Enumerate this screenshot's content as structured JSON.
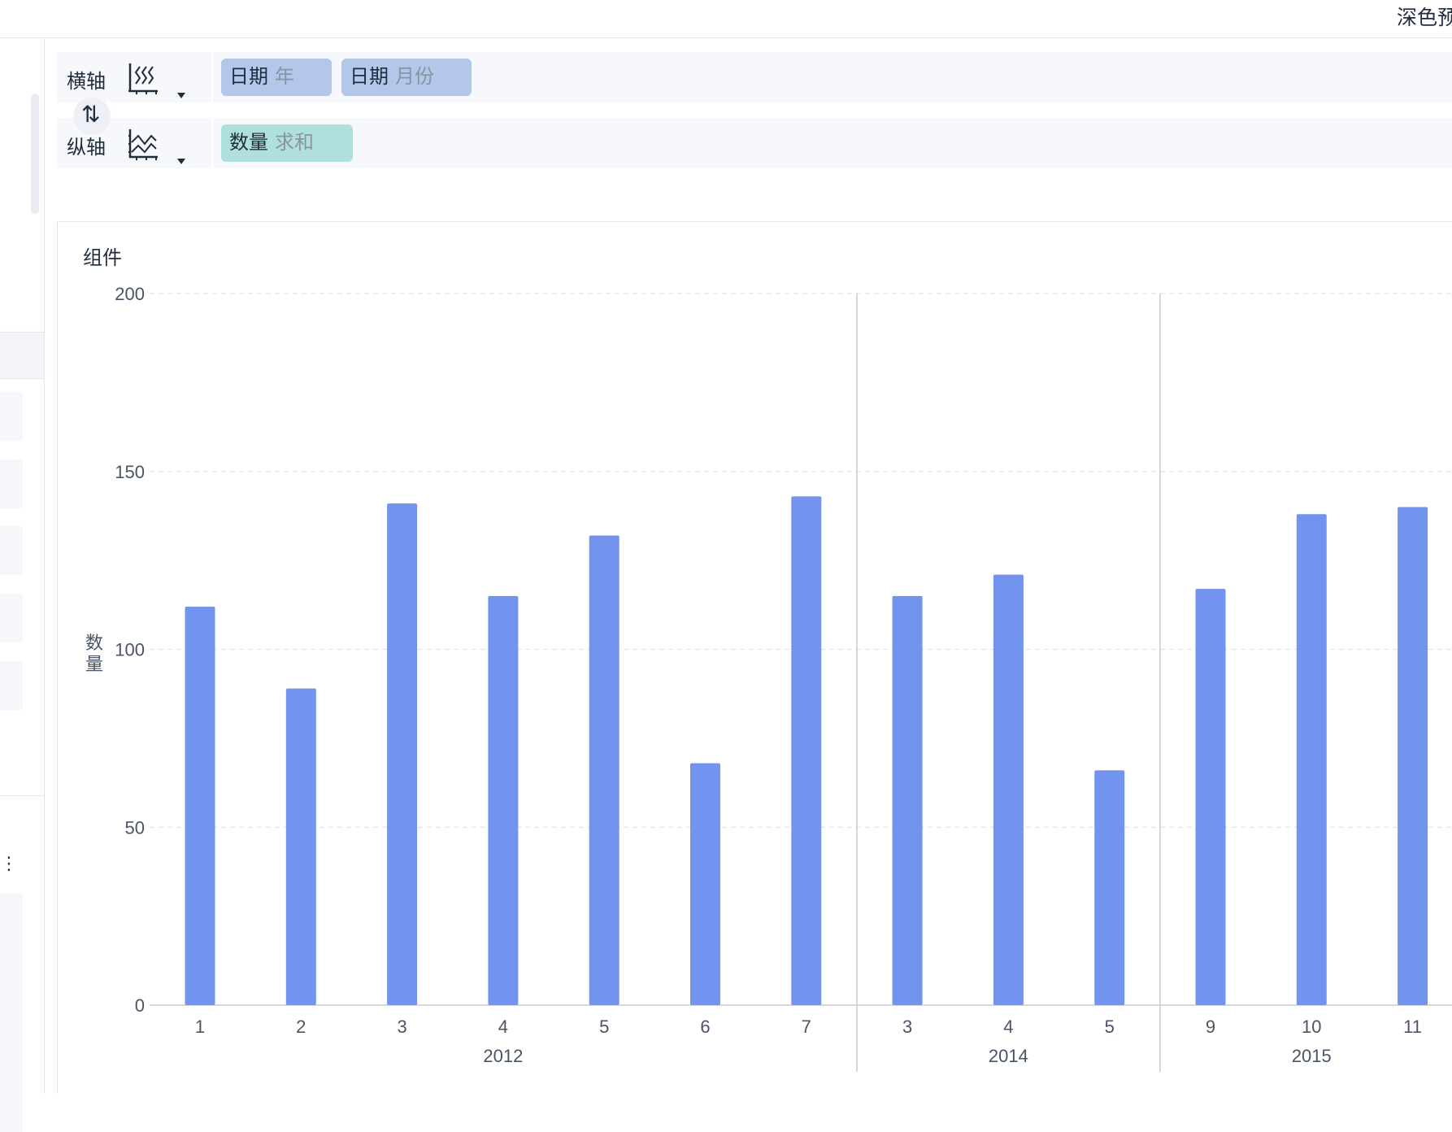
{
  "topbar": {
    "right_text": "深色预"
  },
  "axes": {
    "x_label": "横轴",
    "y_label": "纵轴",
    "swap_icon": "swap-vertical-icon",
    "x_fields": [
      {
        "field": "日期",
        "agg": "年"
      },
      {
        "field": "日期",
        "agg": "月份"
      }
    ],
    "y_fields": [
      {
        "field": "数量",
        "agg": "求和"
      }
    ]
  },
  "card": {
    "title": "组件"
  },
  "colors": {
    "bar": "#7294ee",
    "x_pill": "#b2c7ea",
    "y_pill": "#b0e0db"
  },
  "chart_data": {
    "type": "bar",
    "title": "组件",
    "ylabel": "数量",
    "xlabel": "",
    "ylim": [
      0,
      200
    ],
    "yticks": [
      0,
      50,
      100,
      150,
      200
    ],
    "grid": true,
    "groups": [
      {
        "label": "2012",
        "categories": [
          "1",
          "2",
          "3",
          "4",
          "5",
          "6",
          "7"
        ],
        "values": [
          112,
          89,
          141,
          115,
          132,
          68,
          143
        ]
      },
      {
        "label": "2014",
        "categories": [
          "3",
          "4",
          "5"
        ],
        "values": [
          115,
          121,
          66
        ]
      },
      {
        "label": "2015",
        "categories": [
          "9",
          "10",
          "11"
        ],
        "values": [
          117,
          138,
          140
        ]
      }
    ]
  }
}
